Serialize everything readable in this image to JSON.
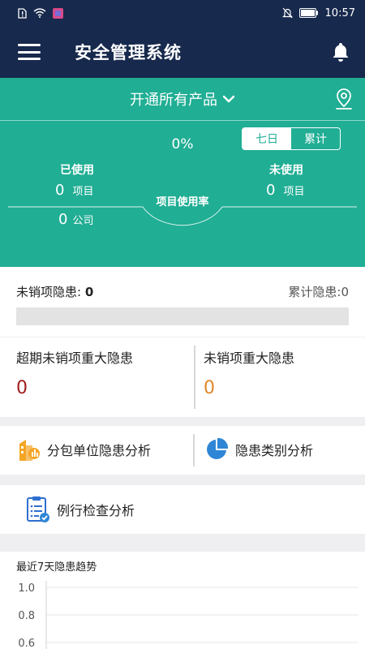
{
  "status_bar": {
    "time": "10:57"
  },
  "header": {
    "title": "安全管理系统"
  },
  "product": {
    "selector_label": "开通所有产品"
  },
  "period_toggle": {
    "options": [
      "七日",
      "累计"
    ],
    "selected": "七日"
  },
  "usage": {
    "used_label": "已使用",
    "used_projects": "0",
    "used_companies": "0",
    "unused_label": "未使用",
    "unused_projects": "0",
    "project_unit": "项目",
    "company_unit": "公司",
    "rate_value": "0%",
    "rate_label": "项目使用率"
  },
  "hazards": {
    "open_label": "未销项隐患:",
    "open_value": "0",
    "total_label": "累计隐患:",
    "total_value": "0",
    "progress": 0
  },
  "major": {
    "overdue_label": "超期未销项重大隐患",
    "overdue_value": "0",
    "open_label": "未销项重大隐患",
    "open_value": "0"
  },
  "menu": {
    "subcontract_analysis": "分包单位隐患分析",
    "category_analysis": "隐患类别分析",
    "routine_analysis": "例行检查分析"
  },
  "colors": {
    "header": "#17294c",
    "primary": "#20ae94",
    "danger": "#a01d1d",
    "warning": "#e1862a",
    "accent_blue": "#2f86d6"
  },
  "chart_data": {
    "type": "line",
    "title": "最近7天隐患趋势",
    "y_ticks": [
      "1.0",
      "0.8",
      "0.6"
    ],
    "series": []
  }
}
